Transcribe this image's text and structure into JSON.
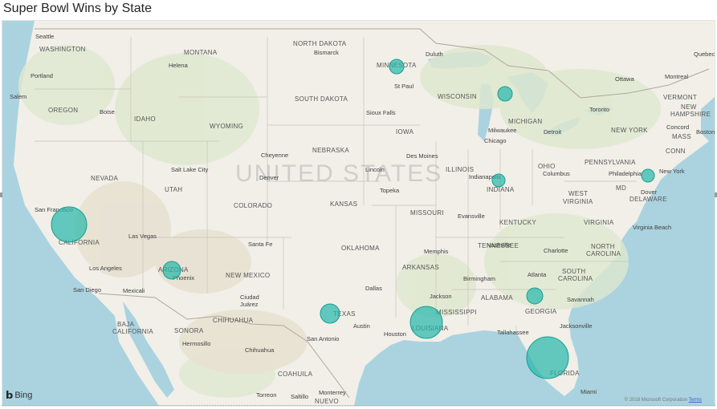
{
  "title": "Super Bowl Wins by State",
  "country_label": "UNITED STATES",
  "states": [
    {
      "label": "WASHINGTON"
    },
    {
      "label": "MONTANA"
    },
    {
      "label": "NORTH DAKOTA"
    },
    {
      "label": "MINNESOTA"
    },
    {
      "label": "OREGON"
    },
    {
      "label": "IDAHO"
    },
    {
      "label": "SOUTH DAKOTA"
    },
    {
      "label": "WISCONSIN"
    },
    {
      "label": "MICHIGAN"
    },
    {
      "label": "WYOMING"
    },
    {
      "label": "IOWA"
    },
    {
      "label": "NEBRASKA"
    },
    {
      "label": "NEVADA"
    },
    {
      "label": "UTAH"
    },
    {
      "label": "COLORADO"
    },
    {
      "label": "KANSAS"
    },
    {
      "label": "ILLINOIS"
    },
    {
      "label": "INDIANA"
    },
    {
      "label": "OHIO"
    },
    {
      "label": "PENNSYLVANIA"
    },
    {
      "label": "NEW YORK"
    },
    {
      "label": "CALIFORNIA"
    },
    {
      "label": "MISSOURI"
    },
    {
      "label": "KENTUCKY"
    },
    {
      "label": "WEST"
    },
    {
      "label": "VIRGINIA"
    },
    {
      "label": "VIRGINIA"
    },
    {
      "label": "MD"
    },
    {
      "label": "DELAWARE"
    },
    {
      "label": "TENNESSEE"
    },
    {
      "label": "NORTH"
    },
    {
      "label": "CAROLINA"
    },
    {
      "label": "OKLAHOMA"
    },
    {
      "label": "ARKANSAS"
    },
    {
      "label": "ARIZONA"
    },
    {
      "label": "NEW MEXICO"
    },
    {
      "label": "SOUTH"
    },
    {
      "label": "CAROLINA"
    },
    {
      "label": "MISSISSIPPI"
    },
    {
      "label": "ALABAMA"
    },
    {
      "label": "GEORGIA"
    },
    {
      "label": "TEXAS"
    },
    {
      "label": "LOUISIANA"
    },
    {
      "label": "FLORIDA"
    },
    {
      "label": "VERMONT"
    },
    {
      "label": "NEW"
    },
    {
      "label": "HAMPSHIRE"
    },
    {
      "label": "MASS"
    },
    {
      "label": "CONN"
    },
    {
      "label": "BAJA"
    },
    {
      "label": "CALIFORNIA"
    },
    {
      "label": "SONORA"
    },
    {
      "label": "CHIHUAHUA"
    },
    {
      "label": "COAHUILA"
    },
    {
      "label": "NUEVO"
    }
  ],
  "cities": [
    {
      "label": "Seattle"
    },
    {
      "label": "Helena"
    },
    {
      "label": "Bismarck"
    },
    {
      "label": "Duluth"
    },
    {
      "label": "Quebec"
    },
    {
      "label": "Portland"
    },
    {
      "label": "St Paul"
    },
    {
      "label": "Ottawa"
    },
    {
      "label": "Montreal"
    },
    {
      "label": "Salem"
    },
    {
      "label": "Boise"
    },
    {
      "label": "Sioux Falls"
    },
    {
      "label": "Toronto"
    },
    {
      "label": "Concord"
    },
    {
      "label": "Boston"
    },
    {
      "label": "Milwaukee"
    },
    {
      "label": "Detroit"
    },
    {
      "label": "Chicago"
    },
    {
      "label": "Cheyenne"
    },
    {
      "label": "Des Moines"
    },
    {
      "label": "Salt Lake City"
    },
    {
      "label": "Denver"
    },
    {
      "label": "Lincoln"
    },
    {
      "label": "Indianapolis"
    },
    {
      "label": "Columbus"
    },
    {
      "label": "Philadelphia"
    },
    {
      "label": "New York"
    },
    {
      "label": "Topeka"
    },
    {
      "label": "Dover"
    },
    {
      "label": "San Francisco"
    },
    {
      "label": "Evansville"
    },
    {
      "label": "Las Vegas"
    },
    {
      "label": "Virginia Beach"
    },
    {
      "label": "Santa Fe"
    },
    {
      "label": "Memphis"
    },
    {
      "label": "Nashville"
    },
    {
      "label": "Charlotte"
    },
    {
      "label": "Los Angeles"
    },
    {
      "label": "Atlanta"
    },
    {
      "label": "Phoenix"
    },
    {
      "label": "Birmingham"
    },
    {
      "label": "San Diego"
    },
    {
      "label": "Mexicali"
    },
    {
      "label": "Dallas"
    },
    {
      "label": "Jackson"
    },
    {
      "label": "Ciudad"
    },
    {
      "label": "Juárez"
    },
    {
      "label": "Savannah"
    },
    {
      "label": "Austin"
    },
    {
      "label": "Houston"
    },
    {
      "label": "Tallahassee"
    },
    {
      "label": "Jacksonville"
    },
    {
      "label": "Hermosillo"
    },
    {
      "label": "San Antonio"
    },
    {
      "label": "Chihuahua"
    },
    {
      "label": "Torreon"
    },
    {
      "label": "Monterrey"
    },
    {
      "label": "Saltillo"
    },
    {
      "label": "Miami"
    }
  ],
  "bubbles": [
    {
      "state": "California"
    },
    {
      "state": "Arizona"
    },
    {
      "state": "Minnesota"
    },
    {
      "state": "Michigan"
    },
    {
      "state": "Indiana"
    },
    {
      "state": "New Jersey"
    },
    {
      "state": "Texas"
    },
    {
      "state": "Louisiana"
    },
    {
      "state": "Georgia"
    },
    {
      "state": "Florida"
    }
  ],
  "attribution": {
    "provider": "Bing",
    "copyright": "© 2018 Microsoft Corporation",
    "link": "Terms"
  },
  "colors": {
    "land": "#f3f1ec",
    "water": "#aad3df",
    "bubble": "#25b7a9"
  }
}
